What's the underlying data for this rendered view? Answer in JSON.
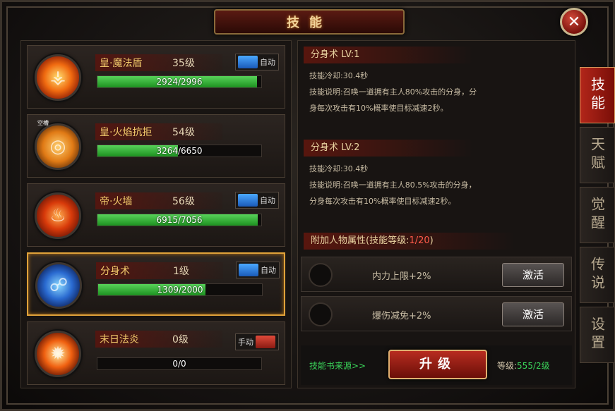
{
  "window": {
    "title": "技能",
    "close_icon": "close-icon"
  },
  "skills": [
    {
      "name": "皇·魔法盾",
      "level": "35级",
      "progress": "2924/2996",
      "fill": 0.976,
      "toggle": "自动",
      "toggle_type": "auto",
      "icon": "shield-flame-icon",
      "selected": false,
      "tag": ""
    },
    {
      "name": "皇·火焰抗拒",
      "level": "54级",
      "progress": "3264/6650",
      "fill": 0.491,
      "toggle": "",
      "toggle_type": "none",
      "icon": "flame-ring-icon",
      "selected": false,
      "tag": "空槽"
    },
    {
      "name": "帝·火墙",
      "level": "56级",
      "progress": "6915/7056",
      "fill": 0.98,
      "toggle": "自动",
      "toggle_type": "auto",
      "icon": "fire-wall-icon",
      "selected": false,
      "tag": ""
    },
    {
      "name": "分身术",
      "level": "1级",
      "progress": "1309/2000",
      "fill": 0.654,
      "toggle": "自动",
      "toggle_type": "auto",
      "icon": "clone-icon",
      "selected": true,
      "tag": ""
    },
    {
      "name": "末日法炎",
      "level": "0级",
      "progress": "0/0",
      "fill": 0,
      "toggle": "手动",
      "toggle_type": "manual",
      "icon": "doom-flame-icon",
      "selected": false,
      "tag": ""
    }
  ],
  "detail": {
    "current": {
      "header": "分身术   LV:1",
      "cooldown": "技能冷却:30.4秒",
      "desc_line1": "技能说明:召唤一道拥有主人80%攻击的分身，分",
      "desc_line2": "身每次攻击有10%概率使目标减速2秒。"
    },
    "next": {
      "header": "分身术   LV:2",
      "cooldown": "技能冷却:30.4秒",
      "desc_line1": "技能说明:召唤一道拥有主人80.5%攻击的分身，",
      "desc_line2": "分身每次攻击有10%概率使目标减速2秒。"
    },
    "attr_header_prefix": "附加人物属性(技能等级:",
    "attr_header_value": "1/20",
    "attr_header_suffix": ")",
    "attributes": [
      {
        "text": "内力上限+2%",
        "button": "激活"
      },
      {
        "text": "爆伤减免+2%",
        "button": "激活"
      }
    ],
    "source_link": "技能书来源>>",
    "upgrade_button": "升级",
    "level_label": "等级:",
    "level_value": "555/2级"
  },
  "side_tabs": [
    {
      "label": "技能",
      "active": true
    },
    {
      "label": "天赋",
      "active": false
    },
    {
      "label": "觉醒",
      "active": false
    },
    {
      "label": "传说",
      "active": false
    },
    {
      "label": "设置",
      "active": false
    }
  ],
  "colors": {
    "accent_red": "#b2261a",
    "bar_green": "#3ad65a",
    "gold": "#f0c86a"
  }
}
